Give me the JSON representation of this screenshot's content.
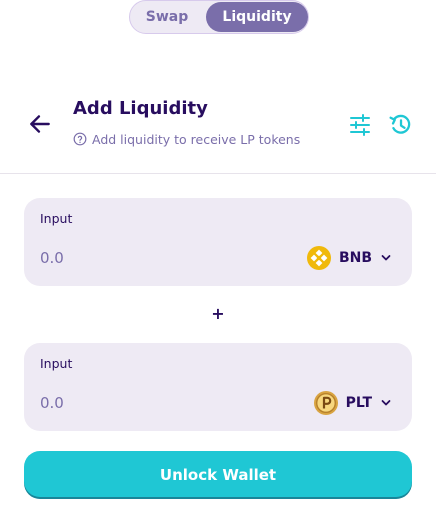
{
  "nav": {
    "tabs": [
      {
        "label": "Swap",
        "active": false
      },
      {
        "label": "Liquidity",
        "active": true
      }
    ]
  },
  "header": {
    "title": "Add Liquidity",
    "subtitle": "Add liquidity to receive LP tokens",
    "icons": {
      "back": "arrow-left-icon",
      "help": "question-circle-icon",
      "settings": "tune-icon",
      "history": "history-icon"
    }
  },
  "inputs": [
    {
      "label": "Input",
      "placeholder": "0.0",
      "token": {
        "symbol": "BNB",
        "logo": "bnb-logo"
      }
    },
    {
      "label": "Input",
      "placeholder": "0.0",
      "token": {
        "symbol": "PLT",
        "logo": "plt-logo"
      }
    }
  ],
  "separator": "+",
  "action": {
    "label": "Unlock Wallet"
  },
  "colors": {
    "primary": "#1fc7d4",
    "secondary": "#7a6eaa",
    "text": "#280d5f",
    "panel": "#eeeaf4"
  }
}
